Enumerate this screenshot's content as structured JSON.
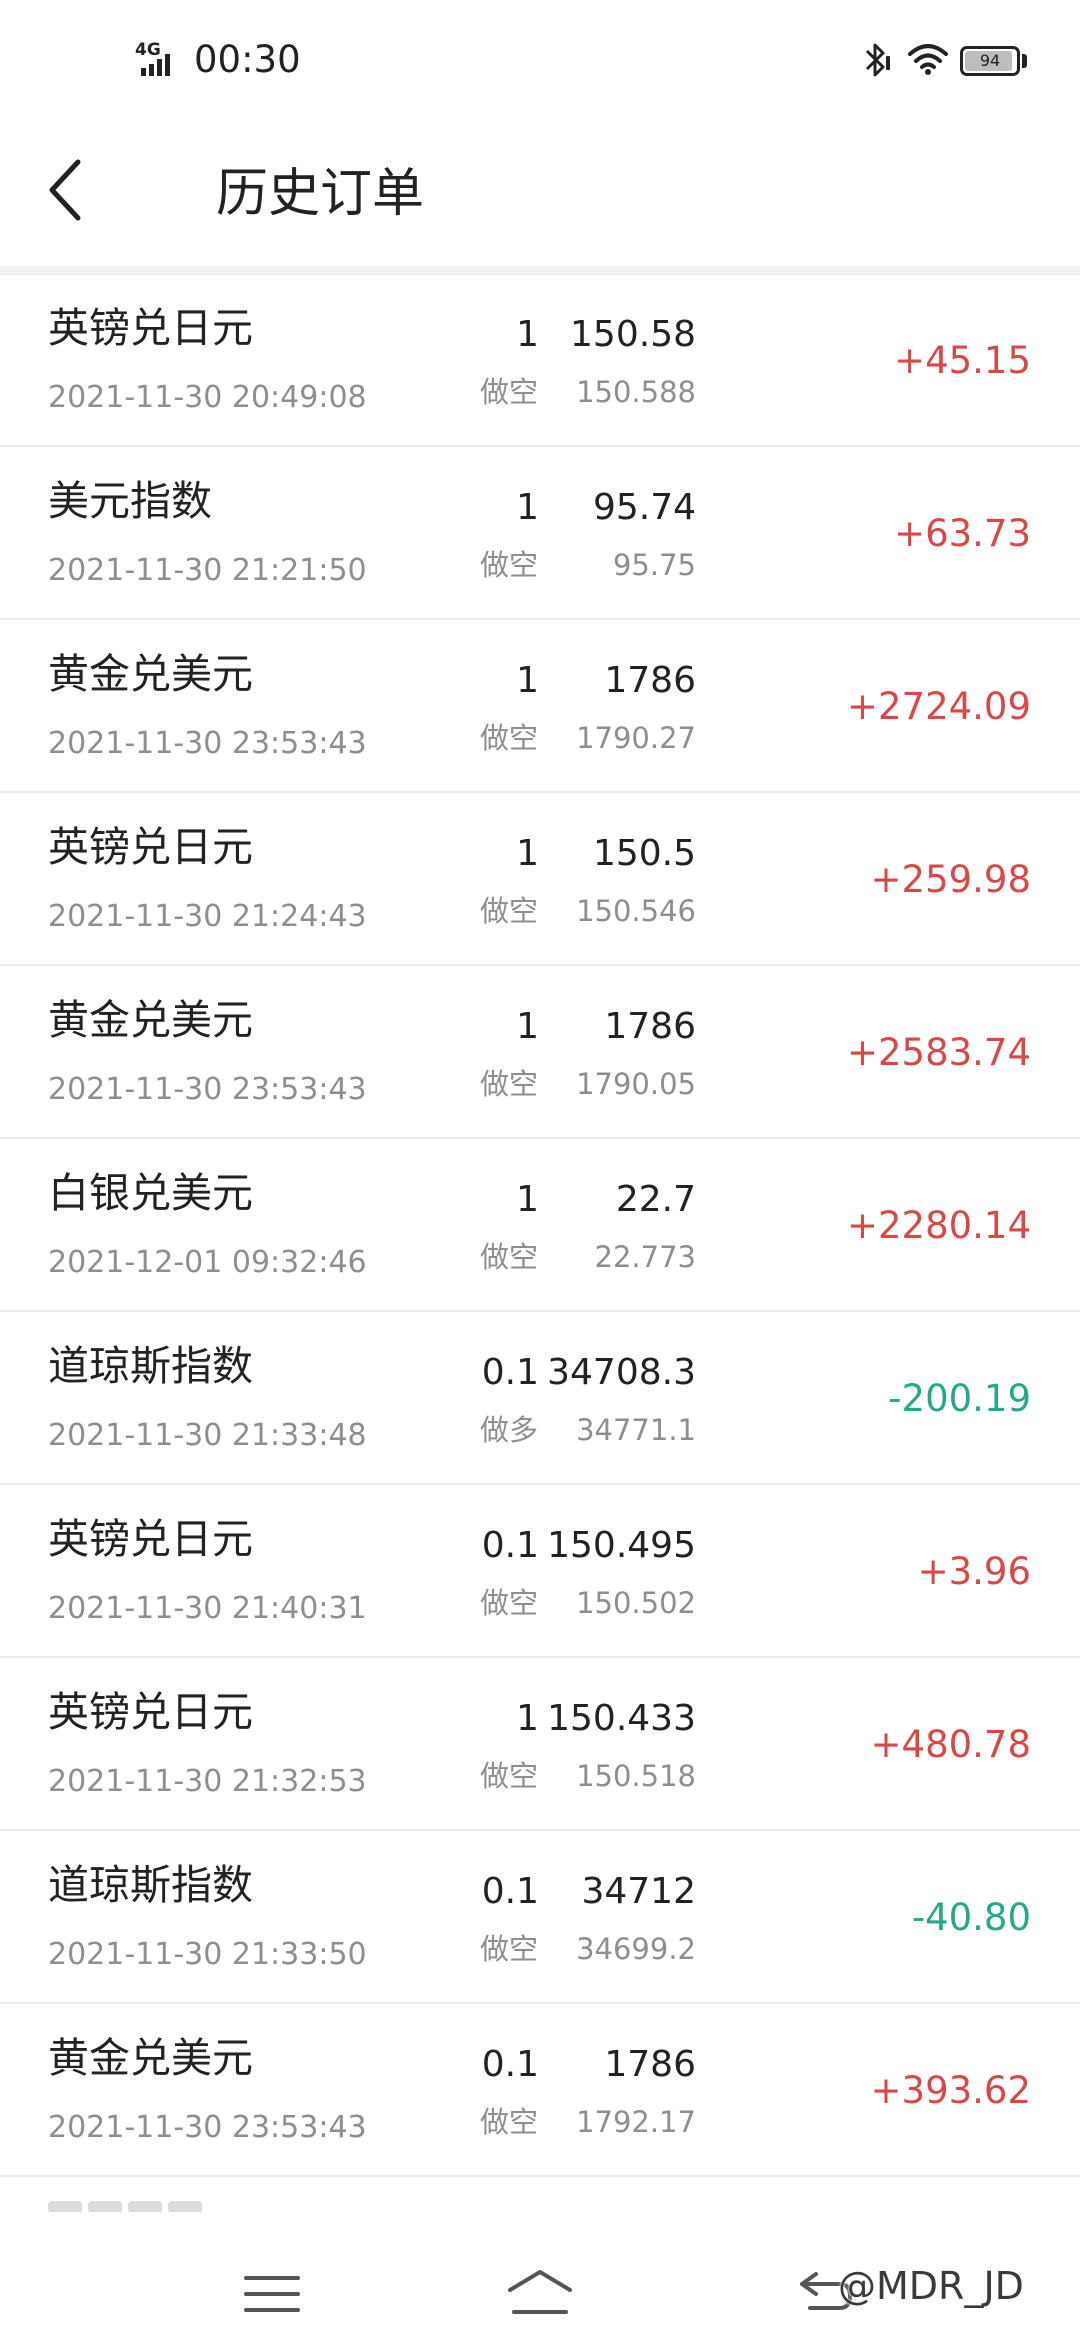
{
  "status_bar": {
    "network": "4G",
    "time": "00:30",
    "battery": "94",
    "battery_level": 0.94,
    "icons": [
      "signal-icon",
      "bluetooth-icon",
      "wifi-icon",
      "battery-icon"
    ]
  },
  "header": {
    "title": "历史订单",
    "back_icon": "chevron-left-icon"
  },
  "colors": {
    "profit": "#d94848",
    "loss": "#27a889",
    "muted_text": "#8e8e8e",
    "primary_text": "#222222"
  },
  "orders": [
    {
      "name": "英镑兑日元",
      "time": "2021-11-30 20:49:08",
      "lots": "1",
      "direction": "做空",
      "open_price": "150.58",
      "close_price": "150.588",
      "pnl": "+45.15",
      "pnl_sign": "pos"
    },
    {
      "name": "美元指数",
      "time": "2021-11-30 21:21:50",
      "lots": "1",
      "direction": "做空",
      "open_price": "95.74",
      "close_price": "95.75",
      "pnl": "+63.73",
      "pnl_sign": "pos"
    },
    {
      "name": "黄金兑美元",
      "time": "2021-11-30 23:53:43",
      "lots": "1",
      "direction": "做空",
      "open_price": "1786",
      "close_price": "1790.27",
      "pnl": "+2724.09",
      "pnl_sign": "pos"
    },
    {
      "name": "英镑兑日元",
      "time": "2021-11-30 21:24:43",
      "lots": "1",
      "direction": "做空",
      "open_price": "150.5",
      "close_price": "150.546",
      "pnl": "+259.98",
      "pnl_sign": "pos"
    },
    {
      "name": "黄金兑美元",
      "time": "2021-11-30 23:53:43",
      "lots": "1",
      "direction": "做空",
      "open_price": "1786",
      "close_price": "1790.05",
      "pnl": "+2583.74",
      "pnl_sign": "pos"
    },
    {
      "name": "白银兑美元",
      "time": "2021-12-01 09:32:46",
      "lots": "1",
      "direction": "做空",
      "open_price": "22.7",
      "close_price": "22.773",
      "pnl": "+2280.14",
      "pnl_sign": "pos"
    },
    {
      "name": "道琼斯指数",
      "time": "2021-11-30 21:33:48",
      "lots": "0.1",
      "direction": "做多",
      "open_price": "34708.3",
      "close_price": "34771.1",
      "pnl": "-200.19",
      "pnl_sign": "neg"
    },
    {
      "name": "英镑兑日元",
      "time": "2021-11-30 21:40:31",
      "lots": "0.1",
      "direction": "做空",
      "open_price": "150.495",
      "close_price": "150.502",
      "pnl": "+3.96",
      "pnl_sign": "pos"
    },
    {
      "name": "英镑兑日元",
      "time": "2021-11-30 21:32:53",
      "lots": "1",
      "direction": "做空",
      "open_price": "150.433",
      "close_price": "150.518",
      "pnl": "+480.78",
      "pnl_sign": "pos"
    },
    {
      "name": "道琼斯指数",
      "time": "2021-11-30 21:33:50",
      "lots": "0.1",
      "direction": "做空",
      "open_price": "34712",
      "close_price": "34699.2",
      "pnl": "-40.80",
      "pnl_sign": "neg"
    },
    {
      "name": "黄金兑美元",
      "time": "2021-11-30 23:53:43",
      "lots": "0.1",
      "direction": "做空",
      "open_price": "1786",
      "close_price": "1792.17",
      "pnl": "+393.62",
      "pnl_sign": "pos"
    }
  ],
  "nav_bar": {
    "icons": [
      "menu-icon",
      "home-icon",
      "back-icon"
    ],
    "watermark": "@MDR_JD"
  }
}
